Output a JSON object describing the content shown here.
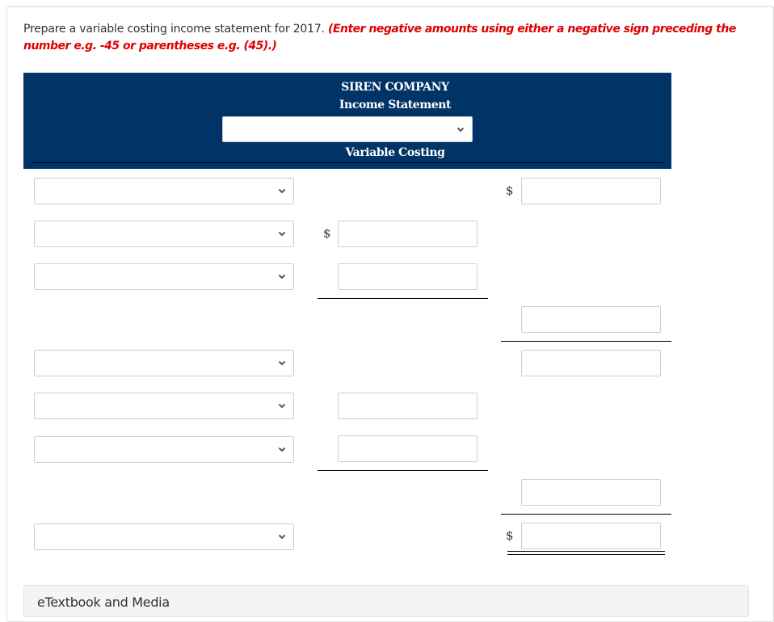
{
  "instructions": {
    "text": "Prepare a variable costing income statement for 2017.",
    "note": "(Enter negative amounts using either a negative sign preceding the number e.g. -45 or parentheses e.g. (45).)"
  },
  "statement": {
    "company": "SIREN COMPANY",
    "title": "Income Statement",
    "period_select": {
      "value": "",
      "icon": "chevron-down-icon"
    },
    "method": "Variable Costing"
  },
  "currency_symbol": "$",
  "rows": [
    {
      "label_select": "",
      "col1": null,
      "col2": "",
      "col1_dollar": false,
      "col2_dollar": true
    },
    {
      "label_select": "",
      "col1": "",
      "col2": null,
      "col1_dollar": true,
      "col2_dollar": false
    },
    {
      "label_select": "",
      "col1": "",
      "col2": null,
      "col1_dollar": false,
      "col2_dollar": false
    },
    {
      "label_select": null,
      "col1": null,
      "col2": "",
      "col1_dollar": false,
      "col2_dollar": false
    },
    {
      "label_select": "",
      "col1": null,
      "col2": "",
      "col1_dollar": false,
      "col2_dollar": false
    },
    {
      "label_select": "",
      "col1": "",
      "col2": null,
      "col1_dollar": false,
      "col2_dollar": false
    },
    {
      "label_select": "",
      "col1": "",
      "col2": null,
      "col1_dollar": false,
      "col2_dollar": false
    },
    {
      "label_select": null,
      "col1": null,
      "col2": "",
      "col1_dollar": false,
      "col2_dollar": false
    },
    {
      "label_select": "",
      "col1": null,
      "col2": "",
      "col1_dollar": false,
      "col2_dollar": true
    }
  ],
  "footer": {
    "etextbook_label": "eTextbook and Media"
  }
}
